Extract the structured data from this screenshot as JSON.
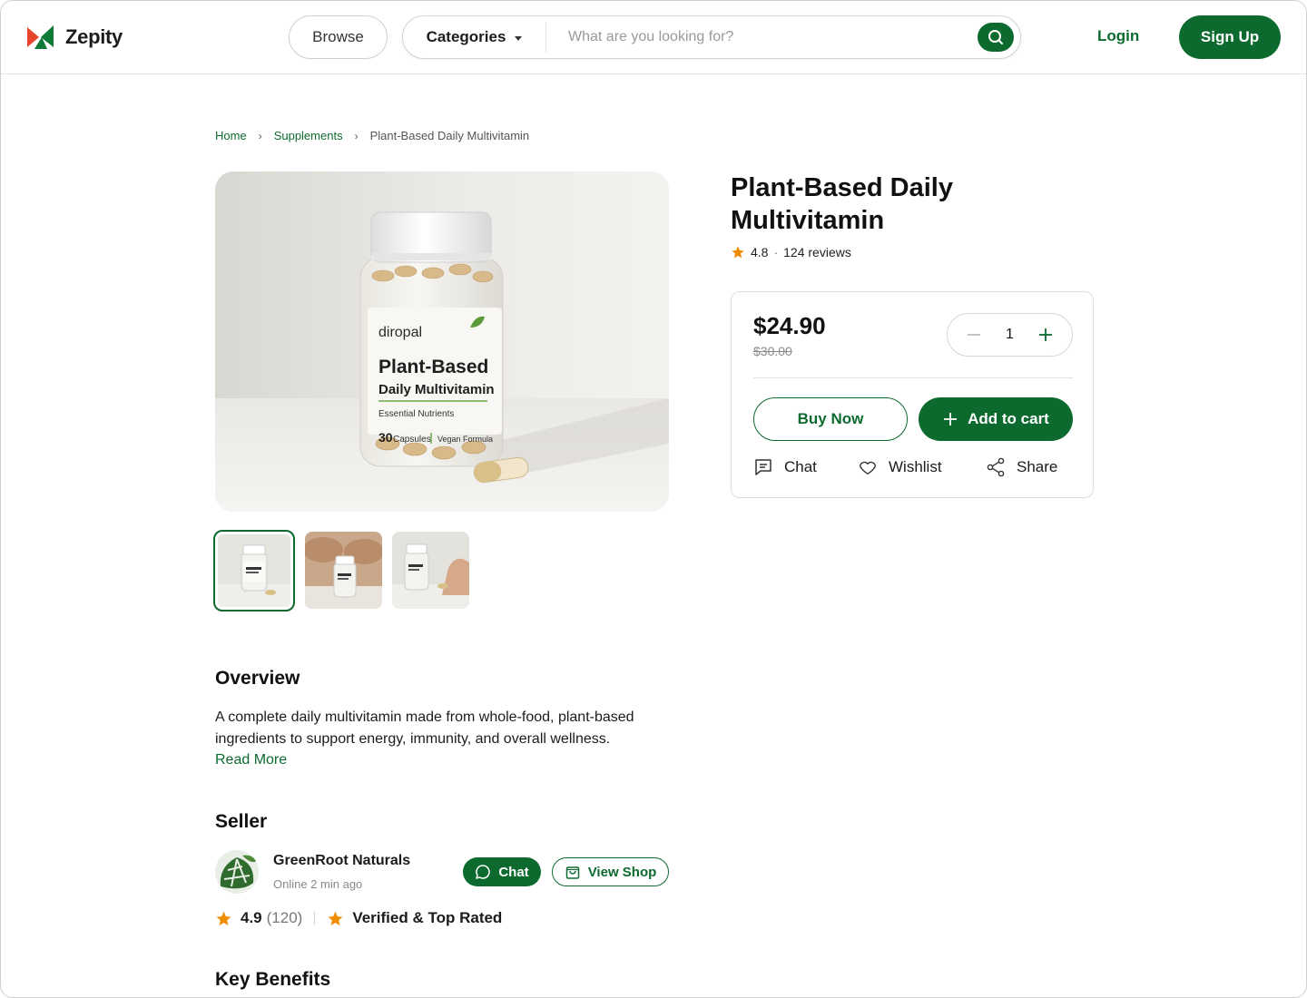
{
  "brand": {
    "name": "Zepity"
  },
  "header": {
    "browse_label": "Browse",
    "categories_label": "Categories",
    "search_placeholder": "What are you looking for?",
    "login_label": "Login",
    "signup_label": "Sign Up"
  },
  "breadcrumb": {
    "home": "Home",
    "category": "Supplements",
    "current": "Plant-Based Daily Multivitamin"
  },
  "product": {
    "title": "Plant-Based Daily Multivitamin",
    "rating": "4.8",
    "reviews": "124 reviews",
    "image_label": {
      "brand": "diropal",
      "line1": "Plant-Based",
      "line2": "Daily Multivitamin",
      "line3": "Essential Nutrients",
      "count": "30",
      "count_unit": "Capsules",
      "formula": "Vegan Formula"
    }
  },
  "purchase": {
    "price": "$24.90",
    "old_price": "$30.00",
    "quantity": "1",
    "buy_now_label": "Buy Now",
    "add_to_cart_label": "Add to cart",
    "chat_label": "Chat",
    "wishlist_label": "Wishlist",
    "share_label": "Share"
  },
  "overview": {
    "title": "Overview",
    "text": "A complete daily multivitamin made from whole-food, plant-based ingredients to support energy, immunity, and overall wellness.",
    "read_more": "Read More"
  },
  "seller": {
    "title": "Seller",
    "name": "GreenRoot Naturals",
    "status": "Online 2 min ago",
    "chat_label": "Chat",
    "view_shop_label": "View Shop",
    "rating": "4.9",
    "rating_count": "(120)",
    "badge": "Verified & Top Rated"
  },
  "key_benefits": {
    "title": "Key Benefits"
  },
  "colors": {
    "brand_green": "#0d6a2f",
    "star_orange": "#f08c00",
    "logo_red": "#e8452c",
    "logo_green": "#0d7a36"
  },
  "icons": {
    "search": "search-icon",
    "caret": "caret-down-icon",
    "minus": "minus-icon",
    "plus": "plus-icon",
    "chat": "chat-icon",
    "heart": "heart-icon",
    "share": "share-icon",
    "star": "star-icon",
    "bag": "shopping-bag-icon"
  }
}
